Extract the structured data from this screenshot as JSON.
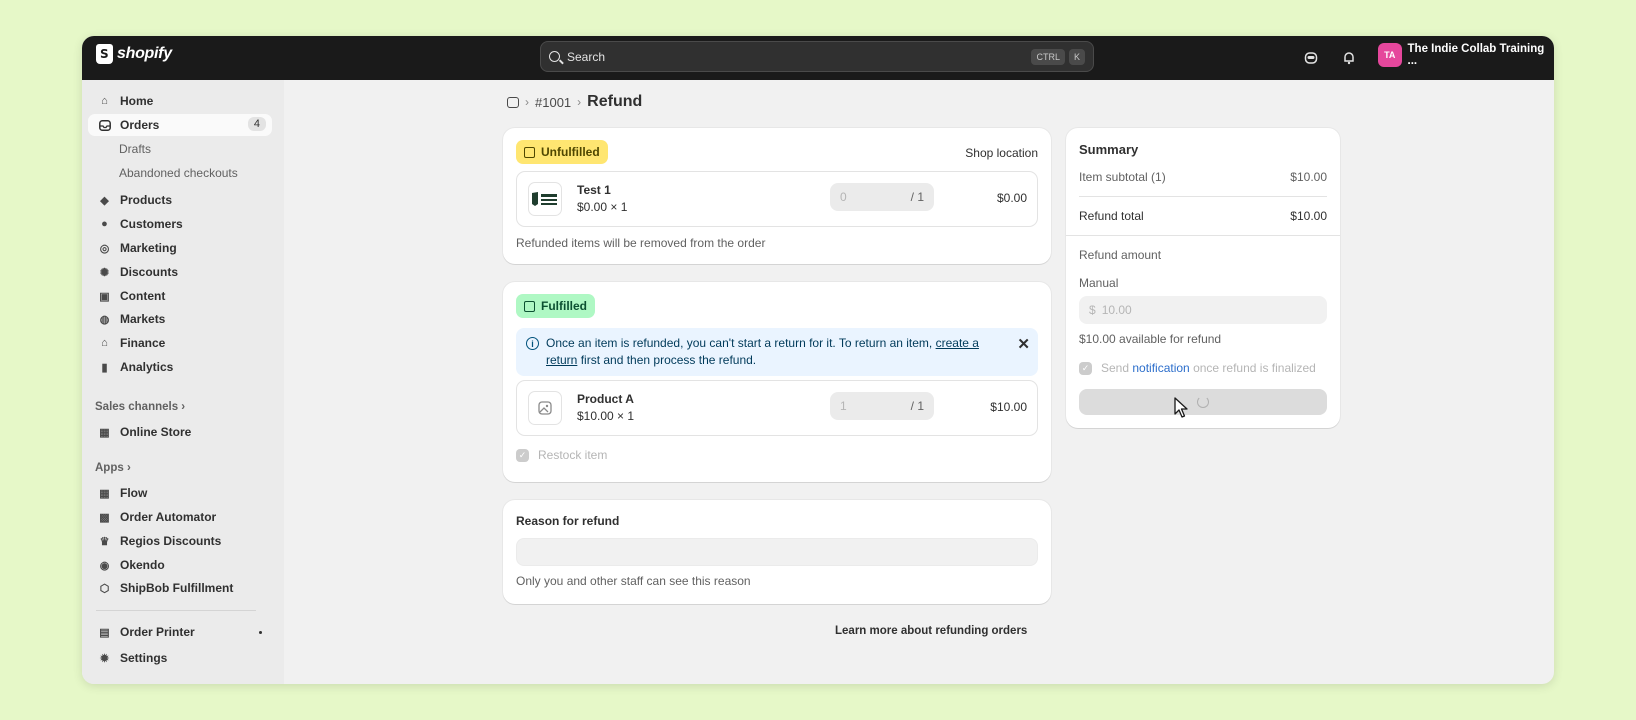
{
  "topbar": {
    "logo_text": "shopify",
    "search_placeholder": "Search",
    "kbd_ctrl": "CTRL",
    "kbd_k": "K",
    "avatar_initials": "TA",
    "store_name": "The Indie Collab Training ..."
  },
  "sidebar": {
    "home": "Home",
    "orders": "Orders",
    "orders_count": "4",
    "drafts": "Drafts",
    "abandoned": "Abandoned checkouts",
    "products": "Products",
    "customers": "Customers",
    "marketing": "Marketing",
    "discounts": "Discounts",
    "content": "Content",
    "markets": "Markets",
    "finance": "Finance",
    "analytics": "Analytics",
    "sales_channels": "Sales channels ›",
    "online_store": "Online Store",
    "apps": "Apps ›",
    "flow": "Flow",
    "order_automator": "Order Automator",
    "regios": "Regios Discounts",
    "okendo": "Okendo",
    "shipbob": "ShipBob Fulfillment",
    "order_printer": "Order Printer",
    "settings": "Settings"
  },
  "breadcrumb": {
    "order": "#1001",
    "title": "Refund",
    "sep": "›"
  },
  "unfulfilled": {
    "badge": "Unfulfilled",
    "location": "Shop location",
    "item_name": "Test 1",
    "item_price": "$0.00  ×  1",
    "qty_value": "0",
    "qty_of": "/ 1",
    "amount": "$0.00",
    "help": "Refunded items will be removed from the order"
  },
  "fulfilled": {
    "badge": "Fulfilled",
    "banner_text_1": "Once an item is refunded, you can't start a return for it. To return an item, ",
    "banner_link": "create a return",
    "banner_text_2": " first and then process the refund.",
    "item_name": "Product A",
    "item_price": "$10.00  ×  1",
    "qty_value": "1",
    "qty_of": "/ 1",
    "amount": "$10.00",
    "restock": "Restock item"
  },
  "reason": {
    "label": "Reason for refund",
    "help": "Only you and other staff can see this reason"
  },
  "summary": {
    "title": "Summary",
    "subtotal_label": "Item subtotal (1)",
    "subtotal_value": "$10.00",
    "total_label": "Refund total",
    "total_value": "$10.00",
    "refund_amount_label": "Refund amount",
    "manual_label": "Manual",
    "currency": "$",
    "amount_placeholder": "10.00",
    "available": "$10.00 available for refund",
    "notify_pre": "Send ",
    "notify_link": "notification",
    "notify_post": " once refund is finalized"
  },
  "footer_link": "Learn more about refunding orders",
  "colors": {
    "page_bg": "#e6f8c8",
    "topbar": "#1a1a1a",
    "unfulfilled_badge": "#ffe671",
    "fulfilled_badge": "#aff8c4",
    "banner_bg": "#eaf4ff",
    "link": "#2c6ecb",
    "avatar": "#e5479c"
  }
}
